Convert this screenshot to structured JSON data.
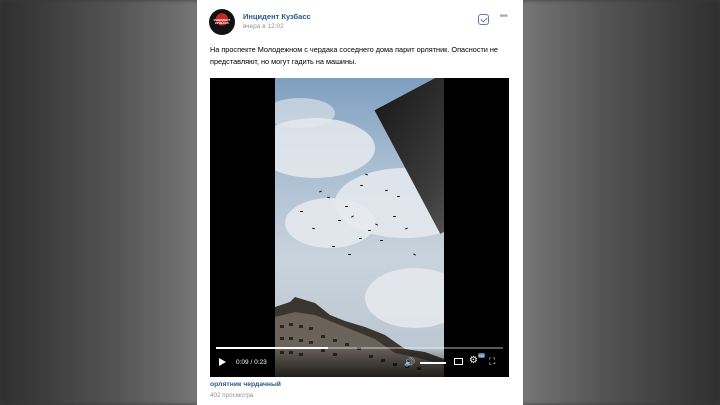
{
  "post": {
    "author": "Инцидент Кузбасс",
    "avatar_text": "ИНЦИДЕНТ КУЗБАСС",
    "time": "вчера в 12:02",
    "text": "На проспекте Молодежном с чердака соседнего дома парит орлятник. Опасности не представляют, но могут гадить на машины."
  },
  "video": {
    "time_display": "0:09 / 0:23",
    "progress": 0.39,
    "hd_badge": "HD",
    "title": "орлятник чердачный",
    "views": "402 просмотра"
  },
  "icons": {
    "play": "play-icon",
    "volume": "volume-icon",
    "pip": "picture-in-picture-icon",
    "settings": "gear-icon",
    "fullscreen": "fullscreen-icon",
    "more": "more-icon",
    "check": "checkbox-icon"
  },
  "colors": {
    "link": "#2a5885",
    "accent": "#5181b8",
    "muted": "#939393"
  }
}
